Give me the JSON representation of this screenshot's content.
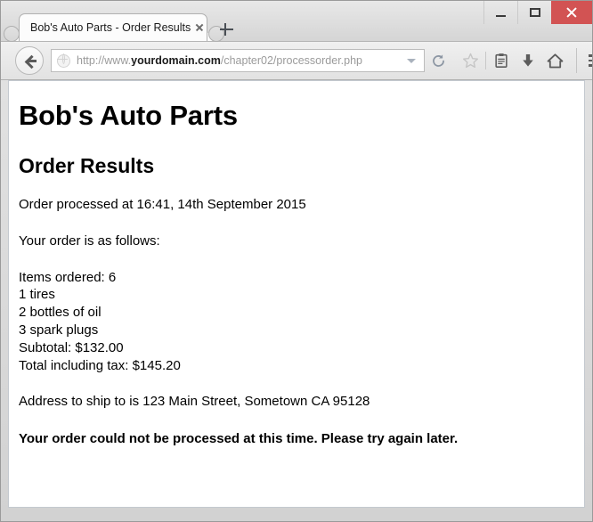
{
  "window": {
    "controls": {
      "minimize_label": "Minimize",
      "maximize_label": "Maximize",
      "close_label": "Close"
    },
    "close_color": "#d25353"
  },
  "tabs": [
    {
      "title": "Bob's Auto Parts - Order Results",
      "active": true
    }
  ],
  "newtab_label": "New Tab",
  "toolbar": {
    "back_label": "Back",
    "url": {
      "prefix": "http://www.",
      "host": "yourdomain.com",
      "path": "/chapter02/processorder.php"
    },
    "reload_label": "Reload",
    "bookmark_label": "Bookmark this page",
    "reader_label": "Reader view",
    "downloads_label": "Downloads",
    "home_label": "Home",
    "menu_label": "Open menu"
  },
  "page": {
    "heading": "Bob's Auto Parts",
    "subheading": "Order Results",
    "processed_line": "Order processed at 16:41, 14th September 2015",
    "intro_line": "Your order is as follows:",
    "order_lines": "Items ordered: 6\n1 tires\n2 bottles of oil\n3 spark plugs\nSubtotal: $132.00\nTotal including tax: $145.20",
    "address_line": "Address to ship to is 123 Main Street, Sometown CA 95128",
    "notice": "Your order could not be processed at this time. Please try again later."
  }
}
